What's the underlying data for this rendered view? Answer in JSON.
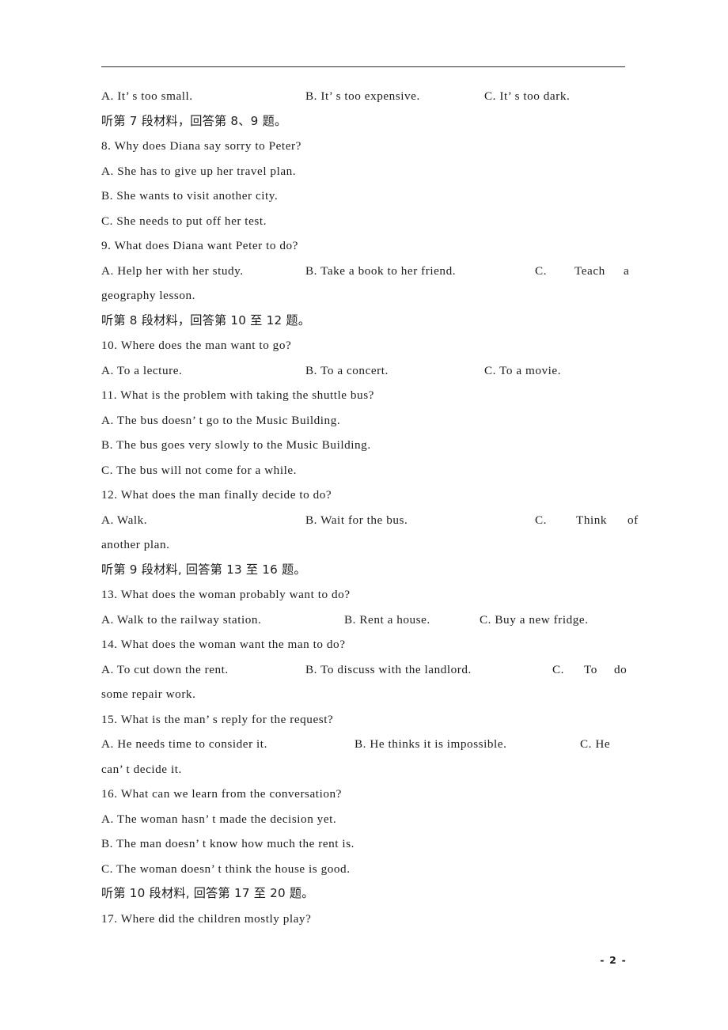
{
  "document": {
    "page_number_label": "- 2 -",
    "has_header_rule": true,
    "ink_color": "#1c1c1c",
    "background_color": "#ffffff"
  },
  "lines": [
    {
      "id": "q7-options",
      "type": "option-row",
      "a": "A. It’ s too small.",
      "b": "B. It’ s too expensive.",
      "c": "C. It’ s too dark."
    },
    {
      "id": "heading-7",
      "type": "cn-heading",
      "text": "听第 7 段材料，回答第 8、9 题。"
    },
    {
      "id": "q8-stem",
      "type": "text",
      "text": "8. Why does Diana say sorry to Peter?"
    },
    {
      "id": "q8-a",
      "type": "text",
      "text": "A. She has to give up her travel plan."
    },
    {
      "id": "q8-b",
      "type": "text",
      "text": "B. She wants to visit another city."
    },
    {
      "id": "q8-c",
      "type": "text",
      "text": "C. She needs to put off her test."
    },
    {
      "id": "q9-stem",
      "type": "text",
      "text": "9. What does Diana want Peter to do?"
    },
    {
      "id": "q9-options",
      "type": "option-row-wrapped",
      "a": "A. Help her with her study.",
      "b": "B. Take a book to her friend.",
      "c_label": "C.",
      "c_word1": "Teach",
      "c_word2": "a",
      "wrap": "geography lesson."
    },
    {
      "id": "heading-8",
      "type": "cn-heading",
      "text": "听第 8 段材料，回答第 10 至 12 题。"
    },
    {
      "id": "q10-stem",
      "type": "text",
      "text": "10. Where does the man want to go?"
    },
    {
      "id": "q10-options",
      "type": "option-row",
      "a": "A. To a lecture.",
      "b": "B. To a concert.",
      "c": "C. To a movie."
    },
    {
      "id": "q11-stem",
      "type": "text",
      "text": "11. What is the problem with taking the shuttle bus?"
    },
    {
      "id": "q11-a",
      "type": "text",
      "text": "A. The bus doesn’ t go to the Music Building."
    },
    {
      "id": "q11-b",
      "type": "text",
      "text": "B. The bus goes very slowly to the Music Building."
    },
    {
      "id": "q11-c",
      "type": "text",
      "text": "C. The bus will not come for a while."
    },
    {
      "id": "q12-stem",
      "type": "text",
      "text": "12. What does the man finally decide to do?"
    },
    {
      "id": "q12-options",
      "type": "option-row-wrapped",
      "a": "A. Walk.",
      "b": "B. Wait for the bus.",
      "c_label": "C.",
      "c_word1": "Think",
      "c_word2": "of",
      "wrap": "another plan."
    },
    {
      "id": "heading-9",
      "type": "cn-heading",
      "text": "听第 9 段材料, 回答第 13 至 16 题。"
    },
    {
      "id": "q13-stem",
      "type": "text",
      "text": "13. What does the woman probably want to do?"
    },
    {
      "id": "q13-options",
      "type": "option-row",
      "a": "A. Walk to the railway station.",
      "b": "B. Rent a house.",
      "c": "C. Buy a new fridge."
    },
    {
      "id": "q14-stem",
      "type": "text",
      "text": "14. What does the woman want the man to do?"
    },
    {
      "id": "q14-options",
      "type": "option-row-wrapped",
      "a": "A. To cut down the rent.",
      "b": "B. To discuss with the landlord.",
      "c_label": "C.",
      "c_word1": "To",
      "c_word2": "do",
      "wrap": "some repair work."
    },
    {
      "id": "q15-stem",
      "type": "text",
      "text": "15. What is the man’ s reply for the request?"
    },
    {
      "id": "q15-options",
      "type": "option-row-wrapped",
      "a": "A. He needs time to consider it.",
      "b": "B. He thinks it is impossible.",
      "c_label": "C. He",
      "c_word1": "",
      "c_word2": "",
      "wrap": "can’ t decide it."
    },
    {
      "id": "q16-stem",
      "type": "text",
      "text": "16. What can we learn from the conversation?"
    },
    {
      "id": "q16-a",
      "type": "text",
      "text": "A. The woman hasn’ t made the decision yet."
    },
    {
      "id": "q16-b",
      "type": "text",
      "text": "B. The man doesn’ t know how much the rent is."
    },
    {
      "id": "q16-c",
      "type": "text",
      "text": "C. The woman doesn’ t think the house is good."
    },
    {
      "id": "heading-10",
      "type": "cn-heading",
      "text": "听第 10 段材料, 回答第 17 至 20 题。"
    },
    {
      "id": "q17-stem",
      "type": "text",
      "text": "17. Where did the children mostly play?"
    }
  ]
}
